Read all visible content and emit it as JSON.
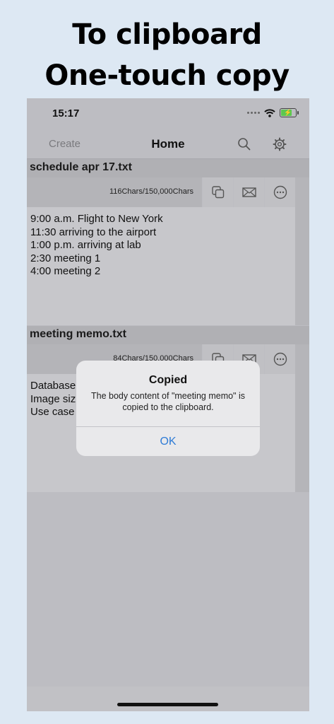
{
  "promo": {
    "line1": "To clipboard",
    "line2": "One-touch copy"
  },
  "status_bar": {
    "time": "15:17",
    "icons": [
      "signal-dots-icon",
      "wifi-icon",
      "battery-charging-icon"
    ],
    "battery_color": "#5cc84f"
  },
  "nav": {
    "create_label": "Create",
    "title": "Home",
    "icons": [
      "search-icon",
      "gear-icon"
    ]
  },
  "files": [
    {
      "name": "schedule apr 17.txt",
      "char_count": "116Chars/150,000Chars",
      "actions": [
        "copy-icon",
        "mail-icon",
        "more-icon"
      ],
      "lines": [
        "9:00 a.m. Flight to New York",
        "11:30 arriving to the airport",
        "1:00 p.m. arriving at lab",
        "2:30 meeting 1",
        "4:00 meeting 2"
      ]
    },
    {
      "name": "meeting memo.txt",
      "char_count": "84Chars/150,000Chars",
      "actions": [
        "copy-icon",
        "mail-icon",
        "more-icon"
      ],
      "lines": [
        "Database",
        "Image siz",
        "Use case"
      ]
    }
  ],
  "alert": {
    "title": "Copied",
    "message": "The body content of \"meeting memo\" is copied to the clipboard.",
    "ok_label": "OK",
    "ok_color": "#2f7cd6"
  }
}
